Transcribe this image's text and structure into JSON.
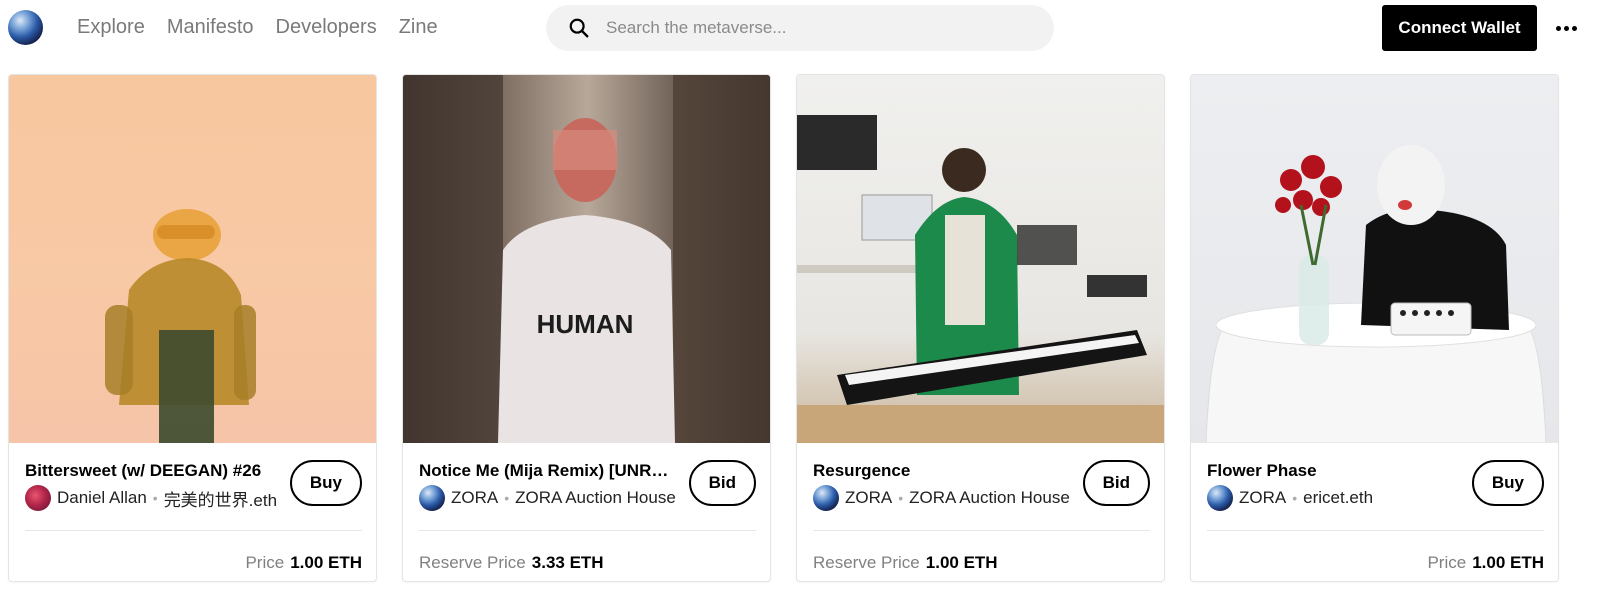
{
  "nav": {
    "links": [
      "Explore",
      "Manifesto",
      "Developers",
      "Zine"
    ]
  },
  "search": {
    "placeholder": "Search the metaverse..."
  },
  "header": {
    "connect_label": "Connect Wallet"
  },
  "cards": [
    {
      "title": "Bittersweet (w/ DEEGAN) #26",
      "creator": "Daniel Allan",
      "owner": "完美的世界.eth",
      "action": "Buy",
      "price_label": "Price",
      "price_value": "1.00 ETH"
    },
    {
      "title": "Notice Me (Mija Remix) [UNRELEASED]",
      "creator": "ZORA",
      "owner": "ZORA Auction House",
      "action": "Bid",
      "price_label": "Reserve Price",
      "price_value": "3.33 ETH",
      "sweater_text": "HUMAN"
    },
    {
      "title": "Resurgence",
      "creator": "ZORA",
      "owner": "ZORA Auction House",
      "action": "Bid",
      "price_label": "Reserve Price",
      "price_value": "1.00 ETH"
    },
    {
      "title": "Flower Phase",
      "creator": "ZORA",
      "owner": "ericet.eth",
      "action": "Buy",
      "price_label": "Price",
      "price_value": "1.00 ETH"
    }
  ]
}
